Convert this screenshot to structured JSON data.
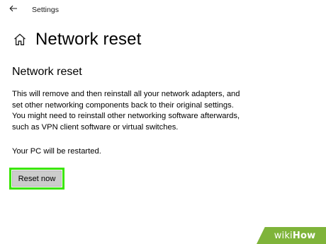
{
  "window": {
    "title": "Settings",
    "back_icon": "arrow-left-icon"
  },
  "header": {
    "icon": "home-icon",
    "title": "Network reset"
  },
  "section": {
    "title": "Network reset",
    "description_lines": [
      "This will remove and then reinstall all your network adapters, and",
      "set other networking components back to their original settings.",
      "You might need to reinstall other networking software afterwards,",
      "such as VPN client software or virtual switches."
    ],
    "restart_note": "Your PC will be restarted.",
    "reset_button_label": "Reset now",
    "highlight_color": "#39e600"
  },
  "watermark": {
    "prefix": "wiki",
    "suffix": "How",
    "color": "#7fb43a"
  }
}
